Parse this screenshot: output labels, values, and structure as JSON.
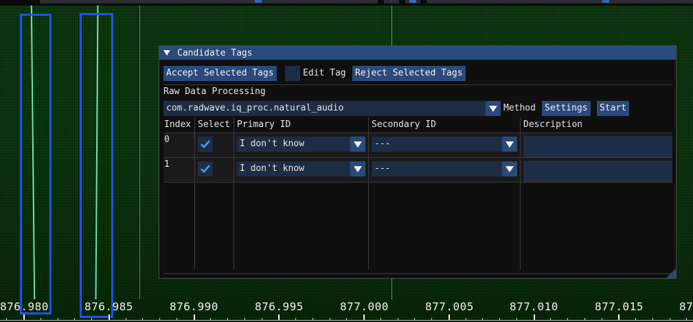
{
  "colors": {
    "accent": "#294a7a",
    "frame_bg": "#1d2d45",
    "selection_box": "#1f4fff",
    "checkmark": "#4a9eff",
    "waterfall": "#0b3a0e"
  },
  "frequency_axis": {
    "labels": [
      "876.980",
      "876.985",
      "876.990",
      "876.995",
      "877.000",
      "877.005",
      "877.010",
      "877.015",
      "87"
    ]
  },
  "window": {
    "title": "Candidate Tags",
    "collapse_icon": "triangle-down-icon",
    "toolbar": {
      "accept_label": "Accept Selected Tags",
      "edit_tag_label": "Edit Tag",
      "reject_label": "Reject Selected Tags"
    },
    "raw_data": {
      "section_label": "Raw Data Processing",
      "method_value": "com.radwave.iq_proc.natural_audio",
      "method_label": "Method",
      "settings_label": "Settings",
      "start_label": "Start"
    },
    "table": {
      "headers": [
        "Index",
        "Select",
        "Primary ID",
        "Secondary ID",
        "Description"
      ],
      "rows": [
        {
          "index": "0",
          "selected": true,
          "primary_id": "I don't know",
          "secondary_id": "---",
          "description": ""
        },
        {
          "index": "1",
          "selected": true,
          "primary_id": "I don't know",
          "secondary_id": "---",
          "description": ""
        }
      ]
    }
  }
}
